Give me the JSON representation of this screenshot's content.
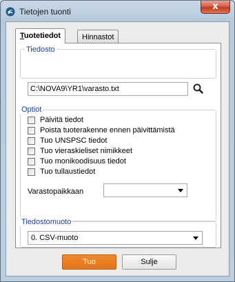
{
  "window": {
    "title": "Tietojen tuonti",
    "close_label": "x"
  },
  "tabs": [
    {
      "label_first": "T",
      "label_rest": "uotetiedot",
      "active": true
    },
    {
      "label_first": "H",
      "label_rest": "innastot",
      "active": false
    }
  ],
  "file_group": {
    "label": "Tiedosto",
    "path_value": "C:\\NOVA9\\YR1\\varasto.txt",
    "browse_icon": "search-icon"
  },
  "options_group": {
    "label": "Optiot",
    "checkboxes": [
      {
        "label": "Päivitä tiedot",
        "checked": false
      },
      {
        "label": "Poista tuoterakenne ennen päivittämistä",
        "checked": false
      },
      {
        "label": "Tuo UNSPSC tiedot",
        "checked": false
      },
      {
        "label": "Tuo vieraskieliset nimikkeet",
        "checked": false
      },
      {
        "label": "Tuo monikoodisuus tiedot",
        "checked": false
      },
      {
        "label": "Tuo tullaustiedot",
        "checked": false
      }
    ],
    "warehouse_label": "Varastopaikkaan",
    "warehouse_value": ""
  },
  "format_group": {
    "label": "Tiedostomuoto",
    "selected": "0. CSV-muoto"
  },
  "buttons": {
    "import": "Tuo",
    "close": "Sulje"
  },
  "colors": {
    "primary": "#e97c22",
    "group_label": "#1a3f9c",
    "close_button": "#c9462d"
  }
}
